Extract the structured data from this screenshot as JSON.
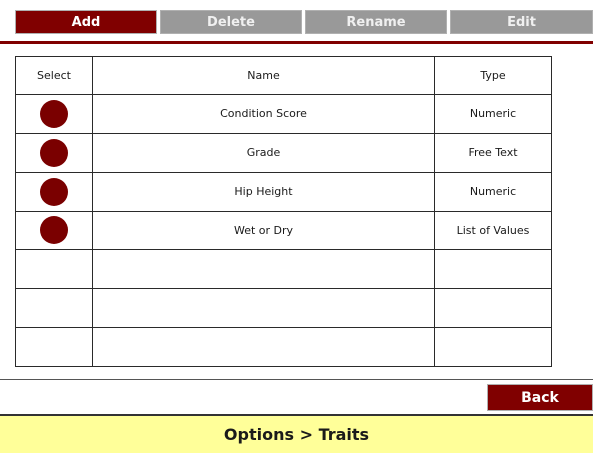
{
  "toolbar": {
    "add_label": "Add",
    "delete_label": "Delete",
    "rename_label": "Rename",
    "edit_label": "Edit"
  },
  "table": {
    "headers": {
      "select": "Select",
      "name": "Name",
      "type": "Type"
    },
    "rows": [
      {
        "name": "Condition Score",
        "type": "Numeric"
      },
      {
        "name": "Grade",
        "type": "Free Text"
      },
      {
        "name": "Hip Height",
        "type": "Numeric"
      },
      {
        "name": "Wet or Dry",
        "type": "List of Values"
      },
      {
        "name": "",
        "type": ""
      },
      {
        "name": "",
        "type": ""
      },
      {
        "name": "",
        "type": ""
      }
    ]
  },
  "footer": {
    "back_label": "Back",
    "breadcrumb": "Options > Traits"
  },
  "colors": {
    "accent": "#800000",
    "disabled": "#999999",
    "status_bar": "#ffff99"
  }
}
